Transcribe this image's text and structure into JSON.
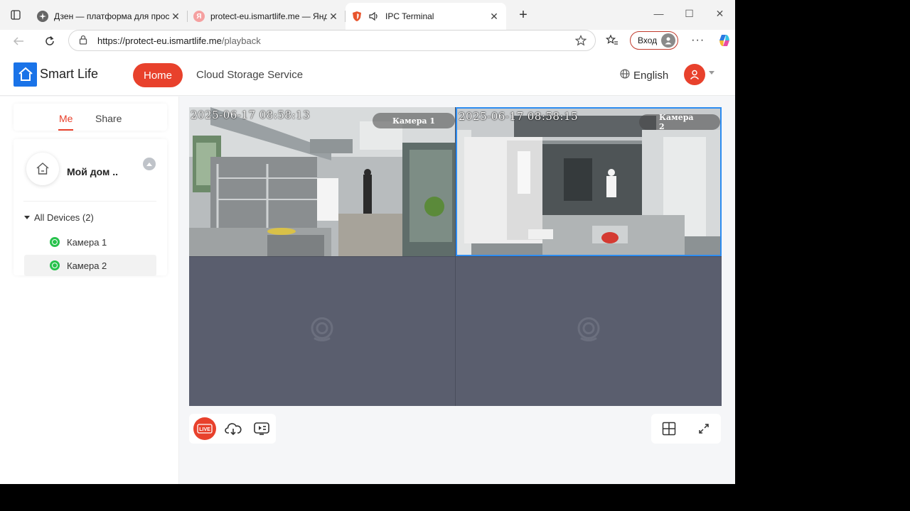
{
  "browser": {
    "tabs": [
      {
        "title": "Дзен — платформа для просмотр",
        "favicon": "dzen-icon"
      },
      {
        "title": "protect-eu.ismartlife.me — Яндекс",
        "favicon": "yandex-icon"
      },
      {
        "title": "IPC Terminal",
        "favicon": "shield-icon",
        "active": true
      }
    ],
    "url_host": "https://protect-eu.ismartlife.me",
    "url_path": "/playback",
    "login_label": "Вход"
  },
  "header": {
    "brand": "Smart Life",
    "home_label": "Home",
    "cloud_label": "Cloud Storage Service",
    "language": "English"
  },
  "sidebar": {
    "tab_me": "Me",
    "tab_share": "Share",
    "home_name": "Мой дом ..",
    "all_devices": "All Devices (2)",
    "devices": [
      {
        "name": "Камера 1",
        "status": "online"
      },
      {
        "name": "Камера 2",
        "status": "online",
        "selected": true
      }
    ]
  },
  "player": {
    "feeds": [
      {
        "timestamp": "2025-06-17 08:58:13",
        "label": "Камера 1"
      },
      {
        "timestamp": "2025-06-17 08:58:15",
        "label": "Камера 2",
        "selected": true
      }
    ],
    "empty_slots": 2
  },
  "colors": {
    "accent": "#e8412c",
    "brand_blue": "#1a73e8",
    "online": "#27c24c",
    "grid_bg": "#5a5e6e",
    "selected_border": "#2d8cf0"
  }
}
